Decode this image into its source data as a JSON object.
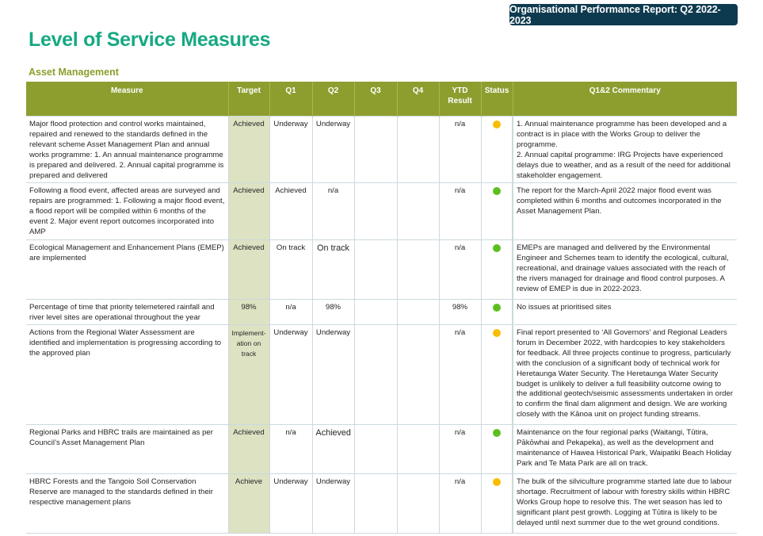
{
  "header": {
    "report_badge": "Organisational Performance Report: Q2 2022-2023",
    "page_title": "Level of Service Measures",
    "section_title": "Asset Management"
  },
  "colors": {
    "badge_bg": "#0e3a4f",
    "title": "#16a982",
    "section": "#8d9e2b",
    "table_header": "#8d9e2f",
    "target_column": "#dde2c2",
    "status_amber": "#f9bd00",
    "status_green": "#5cbf1f"
  },
  "table": {
    "columns": {
      "measure": "Measure",
      "target": "Target",
      "q1": "Q1",
      "q2": "Q2",
      "q3": "Q3",
      "q4": "Q4",
      "ytd": "YTD Result",
      "status": "Status",
      "commentary": "Q1&2 Commentary"
    },
    "rows": [
      {
        "measure": "Major flood protection and control works maintained, repaired and renewed to the standards defined in the relevant scheme Asset Management Plan and annual works programme: 1. An annual maintenance programme is prepared and delivered. 2. Annual capital programme is prepared and delivered",
        "target": "Achieved",
        "q1": "Underway",
        "q2": "Underway",
        "q3": "",
        "q4": "",
        "ytd": "n/a",
        "status": "amber",
        "commentary": [
          "1. Annual maintenance programme has been developed and a contract is in place with the Works Group to deliver the programme.",
          "2. Annual capital programme: IRG Projects have experienced delays due to weather, and as a result of the need for additional stakeholder engagement."
        ]
      },
      {
        "measure": "Following a flood event, affected areas are surveyed and repairs are programmed: 1. Following a major flood event, a flood report will be compiled within 6 months of the event  2. Major event report outcomes incorporated into AMP",
        "target": "Achieved",
        "q1": "Achieved",
        "q2": "n/a",
        "q3": "",
        "q4": "",
        "ytd": "n/a",
        "status": "green",
        "commentary": [
          "The report for the March-April 2022 major flood event was completed within 6 months and outcomes incorporated in the Asset Management Plan."
        ]
      },
      {
        "measure": "Ecological Management and Enhancement Plans (EMEP) are implemented",
        "target": "Achieved",
        "q1": "On track",
        "q2": "On track",
        "q3": "",
        "q4": "",
        "ytd": "n/a",
        "status": "green",
        "commentary": [
          "EMEPs are managed and delivered by the Environmental Engineer and Schemes team to identify the ecological, cultural, recreational, and drainage values associated with the reach of the rivers managed for drainage and flood control purposes. A review of EMEP is due in 2022-2023."
        ]
      },
      {
        "measure": "Percentage of time that priority telemetered rainfall and river level sites are operational throughout the year",
        "target": "98%",
        "q1": "n/a",
        "q2": "98%",
        "q3": "",
        "q4": "",
        "ytd": "98%",
        "status": "green",
        "commentary": [
          "No issues at prioritised sites"
        ]
      },
      {
        "measure": "Actions from the Regional Water Assessment are identified and implementation is progressing according to the approved plan",
        "target": "Implement-ation on track",
        "q1": "Underway",
        "q2": "Underway",
        "q3": "",
        "q4": "",
        "ytd": "n/a",
        "status": "amber",
        "commentary": [
          "Final report presented to ‘All Governors’ and Regional Leaders forum in December 2022, with hardcopies to key stakeholders for feedback. All three projects continue to progress, particularly with the conclusion of a significant body of technical work for Heretaunga Water Security. The Heretaunga Water Security budget is unlikely to deliver a full feasibility outcome owing to the additional geotech/seismic assessments undertaken in order to confirm the final dam alignment and design. We are working closely with the Kānoa unit on project funding streams."
        ]
      },
      {
        "measure": "Regional Parks and HBRC trails are maintained as per Council’s Asset Management Plan",
        "target": "Achieved",
        "q1": "n/a",
        "q2": "Achieved",
        "q3": "",
        "q4": "",
        "ytd": "n/a",
        "status": "green",
        "commentary": [
          "Maintenance on the four regional parks (Waitangi, Tūtira, Pākōwhai and Pekapeka), as well as the development and maintenance of Hawea Historical Park, Waipatiki Beach Holiday Park and Te Mata Park are all on track."
        ]
      },
      {
        "measure": "HBRC Forests and the Tangoio Soil Conservation Reserve are managed to the standards defined in their respective management plans",
        "target": "Achieve",
        "q1": "Underway",
        "q2": "Underway",
        "q3": "",
        "q4": "",
        "ytd": "n/a",
        "status": "amber",
        "commentary": [
          "The bulk of the silviculture programme started late due to labour shortage. Recruitment of labour with forestry skills within HBRC Works Group hope to resolve this. The wet season has led to significant plant pest growth. Logging at Tūtira is likely to be delayed until next summer due to the wet ground conditions."
        ]
      }
    ]
  }
}
